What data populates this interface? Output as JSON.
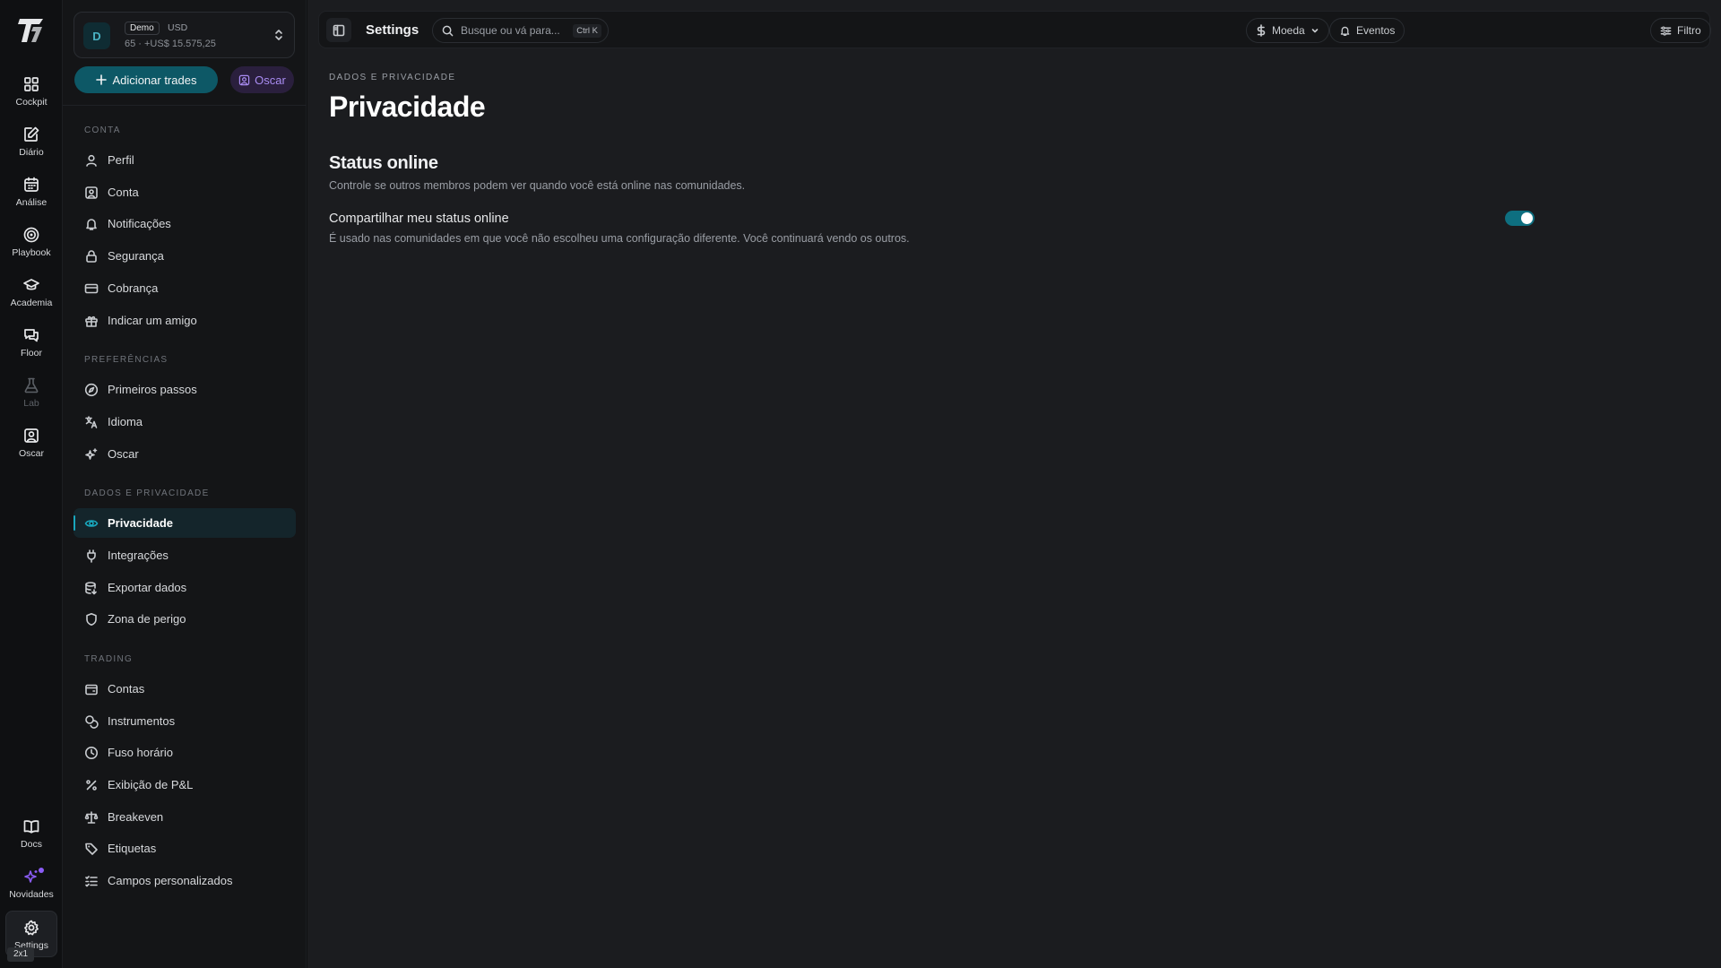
{
  "rail": {
    "items": [
      {
        "label": "Cockpit",
        "icon": "grid-icon"
      },
      {
        "label": "Diário",
        "icon": "journal-edit-icon"
      },
      {
        "label": "Análise",
        "icon": "calendar-icon"
      },
      {
        "label": "Playbook",
        "icon": "target-icon"
      },
      {
        "label": "Academia",
        "icon": "graduation-cap-icon"
      },
      {
        "label": "Floor",
        "icon": "chat-icon"
      },
      {
        "label": "Lab",
        "icon": "flask-icon"
      },
      {
        "label": "Oscar",
        "icon": "portrait-icon"
      }
    ],
    "bottom": [
      {
        "label": "Docs",
        "icon": "book-icon"
      },
      {
        "label": "Novidades",
        "icon": "sparkles-icon"
      },
      {
        "label": "Settings",
        "icon": "gear-icon"
      }
    ],
    "shortcut": "2x1"
  },
  "account": {
    "avatar": "D",
    "tag": "Demo",
    "currency": "USD",
    "summary": "65 · +US$ 15.575,25"
  },
  "sidebar": {
    "add_trades": "Adicionar trades",
    "oscar": "Oscar",
    "sections": {
      "conta": "CONTA",
      "preferencias": "PREFERÊNCIAS",
      "dados": "DADOS E PRIVACIDADE",
      "trading": "TRADING"
    },
    "conta": [
      "Perfil",
      "Conta",
      "Notificações",
      "Segurança",
      "Cobrança",
      "Indicar um amigo"
    ],
    "preferencias": [
      "Primeiros passos",
      "Idioma",
      "Oscar"
    ],
    "dados": [
      "Privacidade",
      "Integrações",
      "Exportar dados",
      "Zona de perigo"
    ],
    "trading": [
      "Contas",
      "Instrumentos",
      "Fuso horário",
      "Exibição de P&L",
      "Breakeven",
      "Etiquetas",
      "Campos personalizados"
    ]
  },
  "topbar": {
    "title": "Settings",
    "search_placeholder": "Busque ou vá para...",
    "search_shortcut": "Ctrl K",
    "currency": "Moeda",
    "events": "Eventos",
    "filter": "Filtro"
  },
  "page": {
    "breadcrumb": "DADOS E PRIVACIDADE",
    "title": "Privacidade",
    "section_title": "Status online",
    "section_desc": "Controle se outros membros podem ver quando você está online nas comunidades.",
    "setting_label": "Compartilhar meu status online",
    "setting_desc": "É usado nas comunidades em que você não escolheu uma configuração diferente. Você continuará vendo os outros.",
    "setting_enabled": true
  },
  "colors": {
    "accent": "#0d5866",
    "accent_bright": "#19a7bd",
    "oscar_purple": "#a98cf2"
  }
}
